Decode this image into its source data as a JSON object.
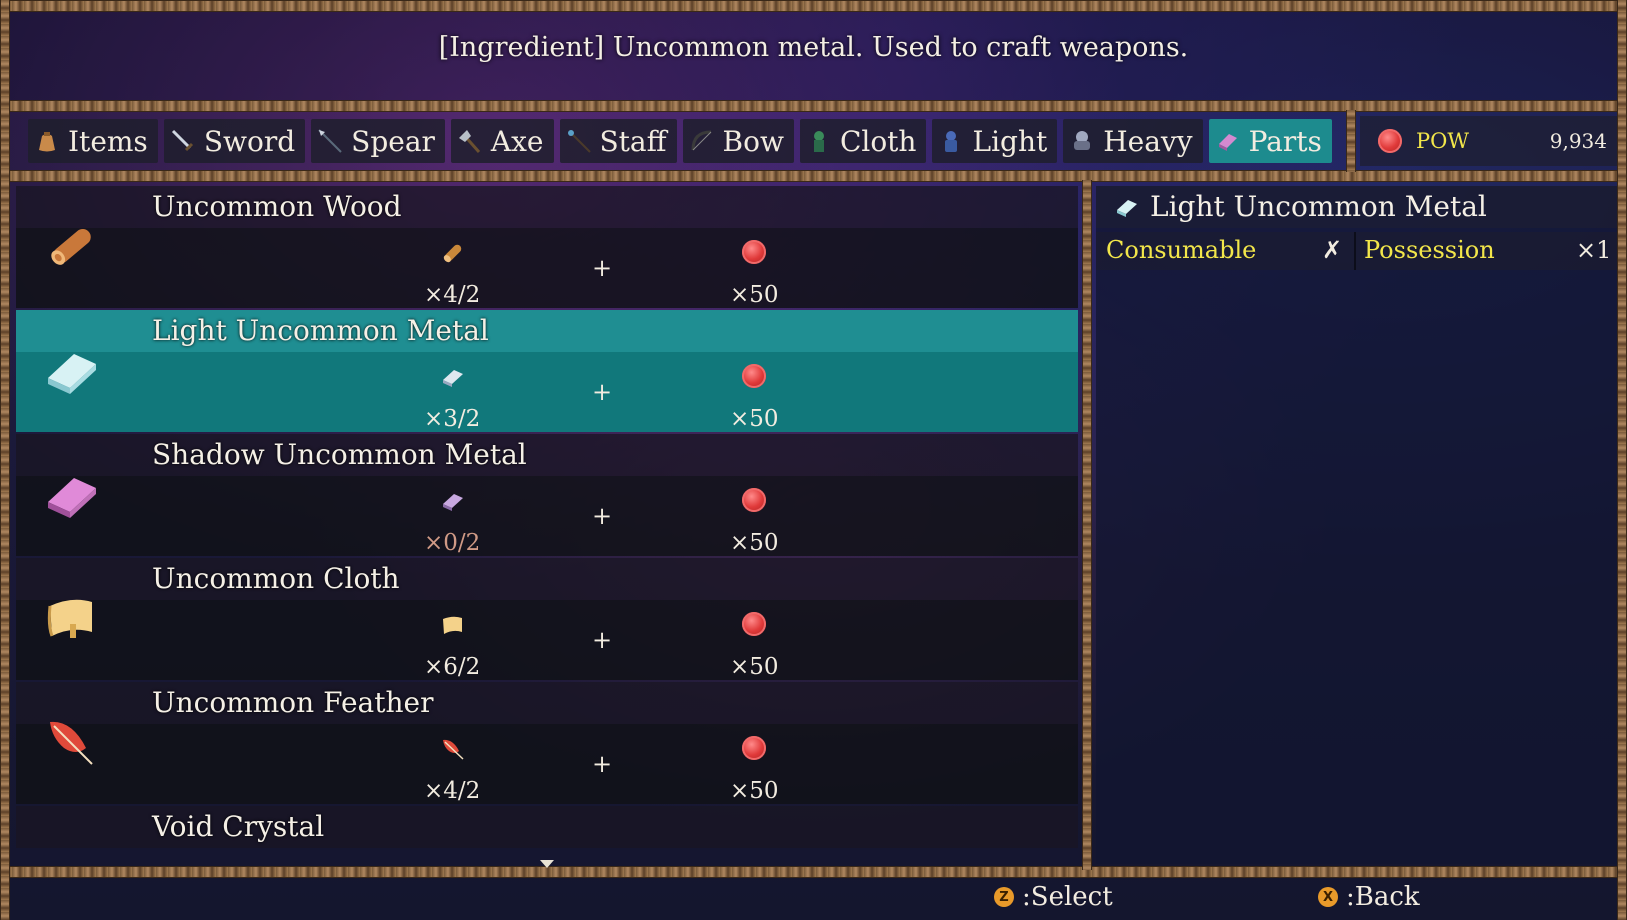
{
  "description": "[Ingredient] Uncommon metal. Used to craft weapons.",
  "tabs": [
    {
      "label": "Items",
      "icon": "bag-icon"
    },
    {
      "label": "Sword",
      "icon": "sword-icon"
    },
    {
      "label": "Spear",
      "icon": "spear-icon"
    },
    {
      "label": "Axe",
      "icon": "axe-icon"
    },
    {
      "label": "Staff",
      "icon": "staff-icon"
    },
    {
      "label": "Bow",
      "icon": "bow-icon"
    },
    {
      "label": "Cloth",
      "icon": "cloth-icon"
    },
    {
      "label": "Light",
      "icon": "light-armor-icon"
    },
    {
      "label": "Heavy",
      "icon": "heavy-armor-icon"
    },
    {
      "label": "Parts",
      "icon": "parts-icon"
    }
  ],
  "active_tab": "Parts",
  "currency": {
    "label": "POW",
    "value": "9,934",
    "icon": "pow-coin-icon"
  },
  "recipes": [
    {
      "name": "Uncommon Wood",
      "icon": "wood-log-icon",
      "material_qty": "×4/2",
      "plus": "+",
      "cost_qty": "×50"
    },
    {
      "name": "Light Uncommon Metal",
      "icon": "light-metal-ingot-icon",
      "material_qty": "×3/2",
      "plus": "+",
      "cost_qty": "×50"
    },
    {
      "name": "Shadow Uncommon Metal",
      "icon": "shadow-metal-ingot-icon",
      "material_qty": "×0/2",
      "plus": "+",
      "cost_qty": "×50"
    },
    {
      "name": "Uncommon Cloth",
      "icon": "cloth-scroll-icon",
      "material_qty": "×6/2",
      "plus": "+",
      "cost_qty": "×50"
    },
    {
      "name": "Uncommon Feather",
      "icon": "feather-icon",
      "material_qty": "×4/2",
      "plus": "+",
      "cost_qty": "×50"
    },
    {
      "name": "Void Crystal"
    }
  ],
  "selected_recipe": "Light Uncommon Metal",
  "detail": {
    "title": "Light Uncommon Metal",
    "consumable_label": "Consumable",
    "consumable_value": "✗",
    "possession_label": "Possession",
    "possession_value": "×1"
  },
  "footer": {
    "select_button": "Z",
    "select_label": ":Select",
    "back_button": "X",
    "back_label": ":Back"
  },
  "colors": {
    "active": "#1d8b8e",
    "highlight_text": "#f2e64a",
    "coin": "#e03a3a"
  }
}
